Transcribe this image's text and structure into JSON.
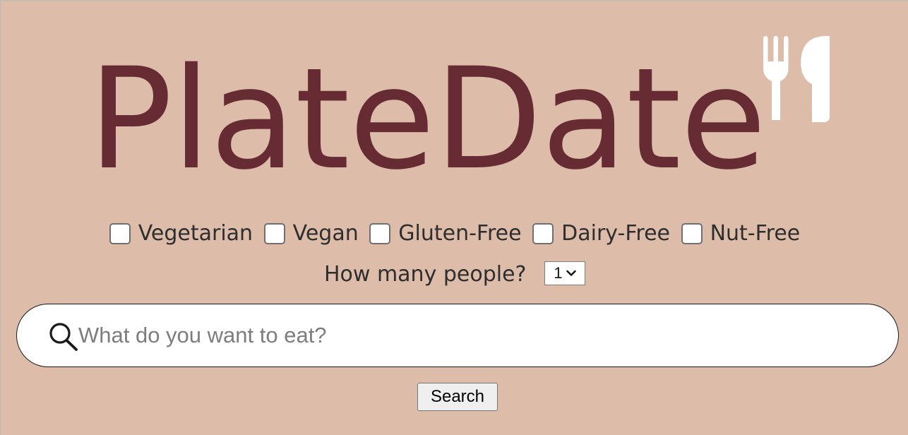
{
  "brand": {
    "name": "PlateDate",
    "text_color": "#662b33",
    "icon": "utensils-icon",
    "icon_color": "#ffffff"
  },
  "background_color": "#ddbcaa",
  "filters": {
    "diet_options": [
      {
        "label": "Vegetarian",
        "checked": false
      },
      {
        "label": "Vegan",
        "checked": false
      },
      {
        "label": "Gluten-Free",
        "checked": false
      },
      {
        "label": "Dairy-Free",
        "checked": false
      },
      {
        "label": "Nut-Free",
        "checked": false
      }
    ],
    "people_label": "How many people?",
    "people_value": "1"
  },
  "search": {
    "icon": "search-icon",
    "placeholder": "What do you want to eat?",
    "value": "",
    "button_label": "Search"
  }
}
